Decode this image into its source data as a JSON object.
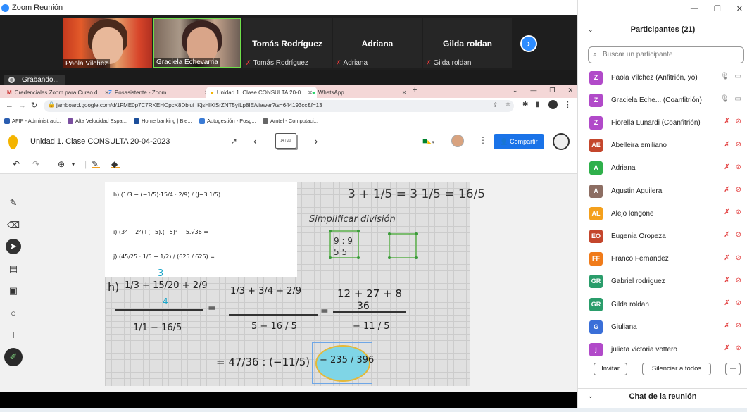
{
  "zoom": {
    "window_title": "Zoom Reunión",
    "recording_label": "Grabando...",
    "tiles": [
      {
        "name": "Paola Vilchez"
      },
      {
        "name": "Graciela Echevarria"
      },
      {
        "name": "Tomás Rodríguez",
        "label": "Tomás Rodríguez"
      },
      {
        "name": "Adriana",
        "label": "Adriana"
      },
      {
        "name": "Gilda roldan",
        "label": "Gilda roldan"
      }
    ],
    "next_glyph": "›"
  },
  "browser": {
    "tabs": [
      {
        "label": "Credenciales Zoom para Curso d"
      },
      {
        "label": "Posasistente - Zoom"
      },
      {
        "label": "Unidad 1. Clase CONSULTA 20-0"
      },
      {
        "label": "WhatsApp"
      }
    ],
    "url": "jamboard.google.com/d/1FME0p7C7RKEHOpcK8Dblui_KjsHlXlSrZNT5yfLp8IE/viewer?ts=644193cc&f=13",
    "bookmarks": [
      {
        "label": "AFIP - Administraci...",
        "color": "#2a5db0"
      },
      {
        "label": "Alta Velocidad Espa...",
        "color": "#7a4fa0"
      },
      {
        "label": "Home banking | Bie...",
        "color": "#1c4e9a"
      },
      {
        "label": "Autogestión - Posg...",
        "color": "#3a7bd5"
      },
      {
        "label": "Amtel - Computaci...",
        "color": "#666666"
      }
    ]
  },
  "jamboard": {
    "title": "Unidad 1. Clase CONSULTA 20-04-2023",
    "frame_counter": "14 / 20",
    "share_label": "Compartir",
    "handwriting": {
      "top_right_expr": "3 + 1/5 = 3 1/5 = 16/5",
      "simplify_note": "Simplificar división",
      "h_label": "h)",
      "h_numerator": "1/3 + 15/20 + 2/9",
      "h_denominator": "1/1 − 16/5",
      "step2_num": "1/3 + 3/4 + 2/9",
      "step2_den": "5 − 16 / 5",
      "step3_num": "12 + 27 + 8",
      "step3_den": "36",
      "step3_bottom": "− 11 / 5",
      "result_left": "= 47/36 : (−11/5)",
      "result_highlight": "− 235 / 396",
      "annot_3": "3",
      "annot_4": "4"
    },
    "pasted_exercise": {
      "h_line": "h) (1/3 − (−1/5)·15/4 · 2/9) / (J−3 1/5)",
      "i_line": "i) (3² − 2²)+(−5).(−5)² − 5.√36 =",
      "j_line": "j) (45/25 · 1/5 − 1/2) / (625 / 625) ="
    }
  },
  "participants": {
    "header": "Participantes (21)",
    "search_placeholder": "Buscar un participante",
    "list": [
      {
        "initials": "Z",
        "name": "Paola Vilchez (Anfitrión, yo)",
        "color": "#b14ac9",
        "mic": "on",
        "cam": "on"
      },
      {
        "initials": "Z",
        "name": "Graciela Eche...  (Coanfitrión)",
        "color": "#b14ac9",
        "mic": "on",
        "cam": "on"
      },
      {
        "initials": "Z",
        "name": "Fiorella Lunardi (Coanfitrión)",
        "color": "#b14ac9",
        "mic": "off",
        "cam": "off"
      },
      {
        "initials": "AE",
        "name": "Abelleira emiliano",
        "color": "#c4462c",
        "mic": "off",
        "cam": "off"
      },
      {
        "initials": "A",
        "name": "Adriana",
        "color": "#2fb04b",
        "mic": "off",
        "cam": "off"
      },
      {
        "initials": "A",
        "name": "Agustin Aguilera",
        "color": "#8d6e63",
        "mic": "off",
        "cam": "off"
      },
      {
        "initials": "AL",
        "name": "Alejo longone",
        "color": "#f4a01c",
        "mic": "off",
        "cam": "off"
      },
      {
        "initials": "EO",
        "name": "Eugenia Oropeza",
        "color": "#c4462c",
        "mic": "off",
        "cam": "off"
      },
      {
        "initials": "FF",
        "name": "Franco Fernandez",
        "color": "#f07b1a",
        "mic": "off",
        "cam": "off"
      },
      {
        "initials": "GR",
        "name": "Gabriel rodriguez",
        "color": "#2a9d6b",
        "mic": "off",
        "cam": "off"
      },
      {
        "initials": "GR",
        "name": "Gilda roldan",
        "color": "#2a9d6b",
        "mic": "off",
        "cam": "off"
      },
      {
        "initials": "G",
        "name": "Giuliana",
        "color": "#3a6fd8",
        "mic": "off",
        "cam": "off"
      },
      {
        "initials": "j",
        "name": "julieta victoria vottero",
        "color": "#b14ac9",
        "mic": "off",
        "cam": "off"
      }
    ],
    "invite_label": "Invitar",
    "mute_all_label": "Silenciar a todos",
    "more_label": "···",
    "chat_header": "Chat de la reunión"
  }
}
